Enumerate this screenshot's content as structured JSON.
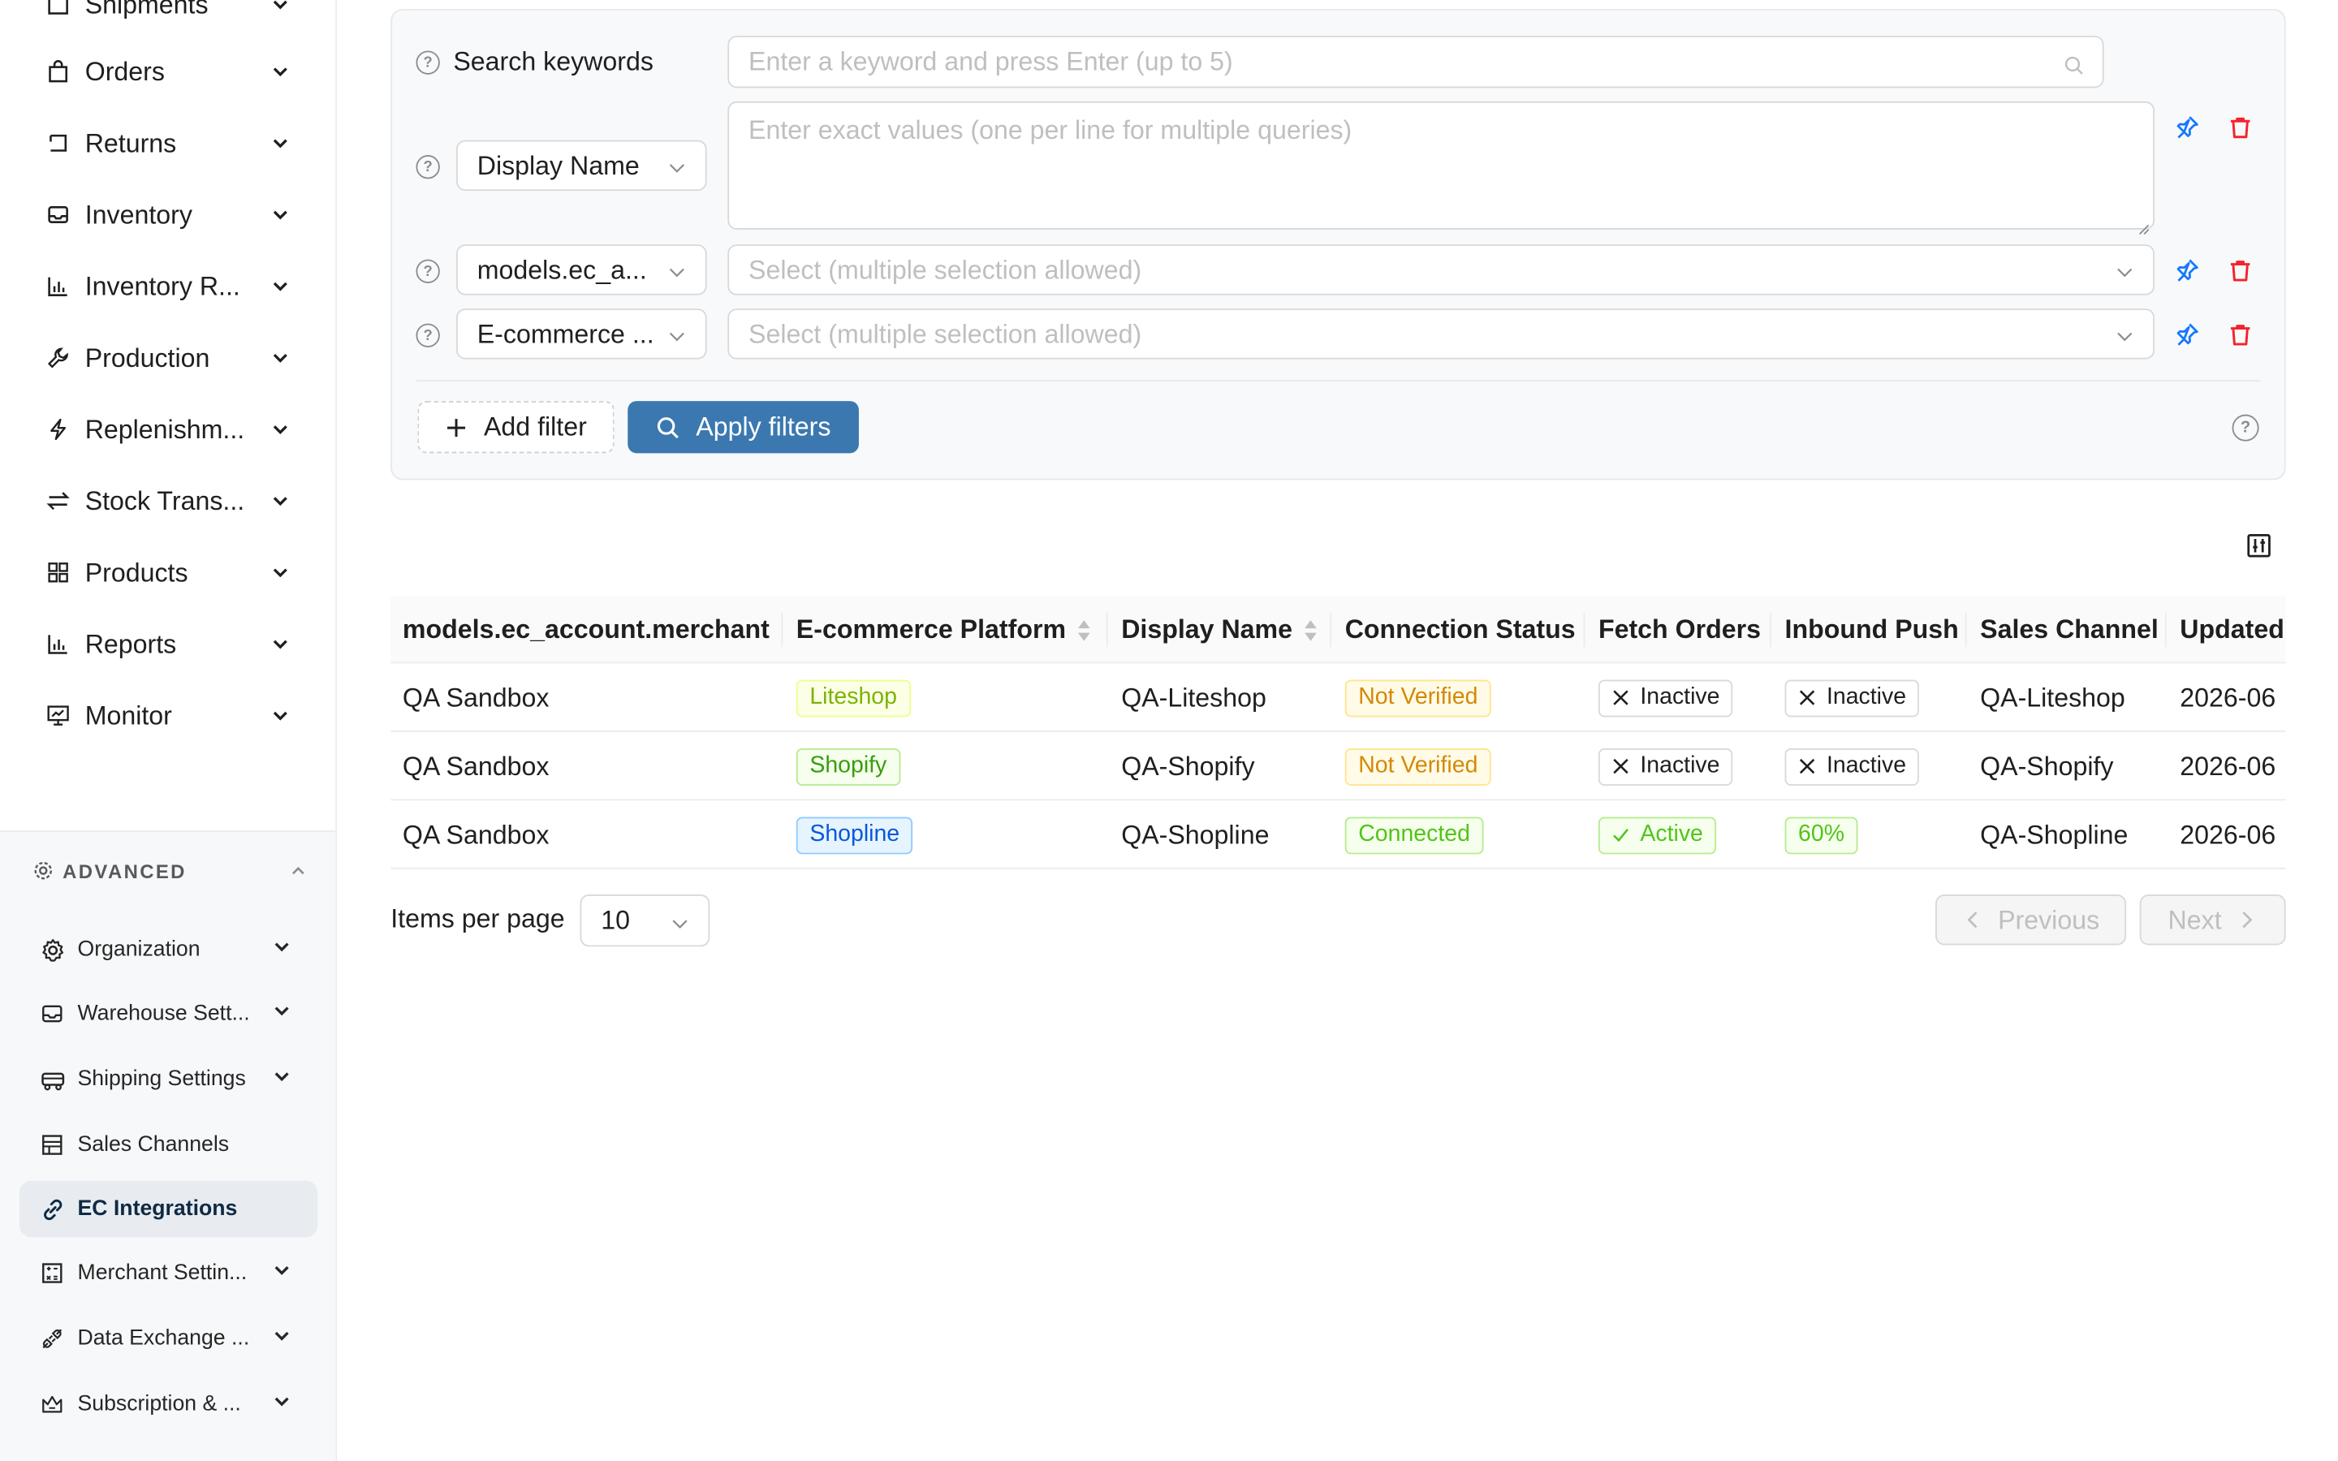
{
  "sidebar": {
    "items": [
      {
        "label": "Shipments",
        "icon": "box-icon"
      },
      {
        "label": "Orders",
        "icon": "bag-icon"
      },
      {
        "label": "Returns",
        "icon": "return-icon"
      },
      {
        "label": "Inventory",
        "icon": "inbox-icon"
      },
      {
        "label": "Inventory R...",
        "icon": "bar-chart-icon"
      },
      {
        "label": "Production",
        "icon": "wrench-icon"
      },
      {
        "label": "Replenishm...",
        "icon": "bolt-icon"
      },
      {
        "label": "Stock Trans...",
        "icon": "swap-icon"
      },
      {
        "label": "Products",
        "icon": "grid-icon"
      },
      {
        "label": "Reports",
        "icon": "bar-chart-icon"
      },
      {
        "label": "Monitor",
        "icon": "monitor-icon"
      }
    ],
    "advanced_title": "ADVANCED",
    "advanced_items": [
      {
        "label": "Organization",
        "icon": "gear-icon"
      },
      {
        "label": "Warehouse Sett...",
        "icon": "inbox-icon"
      },
      {
        "label": "Shipping Settings",
        "icon": "truck-icon"
      },
      {
        "label": "Sales Channels",
        "icon": "shop-icon"
      },
      {
        "label": "EC Integrations",
        "icon": "link-icon",
        "active": true
      },
      {
        "label": "Merchant Settin...",
        "icon": "calculator-icon"
      },
      {
        "label": "Data Exchange ...",
        "icon": "api-icon"
      },
      {
        "label": "Subscription & ...",
        "icon": "crown-icon"
      }
    ]
  },
  "filters": {
    "keywords_label": "Search keywords",
    "keywords_placeholder": "Enter a keyword and press Enter (up to 5)",
    "field1_select": "Display Name",
    "field1_placeholder": "Enter exact values (one per line for multiple queries)",
    "field2_select": "models.ec_a...",
    "field2_placeholder": "Select (multiple selection allowed)",
    "field3_select": "E-commerce ...",
    "field3_placeholder": "Select (multiple selection allowed)",
    "add_filter": "Add filter",
    "apply_filters": "Apply filters"
  },
  "table": {
    "columns": [
      "models.ec_account.merchant",
      "E-commerce Platform",
      "Display Name",
      "Connection Status",
      "Fetch Orders",
      "Inbound Push",
      "Sales Channel",
      "Updated"
    ],
    "rows": [
      {
        "merchant": "QA Sandbox",
        "platform": "Liteshop",
        "display": "QA-Liteshop",
        "status": "Not Verified",
        "fetch": "Inactive",
        "push": "Inactive",
        "channel": "QA-Liteshop",
        "updated": "2026-06"
      },
      {
        "merchant": "QA Sandbox",
        "platform": "Shopify",
        "display": "QA-Shopify",
        "status": "Not Verified",
        "fetch": "Inactive",
        "push": "Inactive",
        "channel": "QA-Shopify",
        "updated": "2026-06"
      },
      {
        "merchant": "QA Sandbox",
        "platform": "Shopline",
        "display": "QA-Shopline",
        "status": "Connected",
        "fetch": "Active",
        "push": "60%",
        "channel": "QA-Shopline",
        "updated": "2026-06"
      }
    ]
  },
  "pagination": {
    "items_per_page_label": "Items per page",
    "page_size": "10",
    "previous": "Previous",
    "next": "Next"
  },
  "colors": {
    "primary": "#3b78b0",
    "danger": "#f5222d",
    "pin": "#1677ff"
  }
}
